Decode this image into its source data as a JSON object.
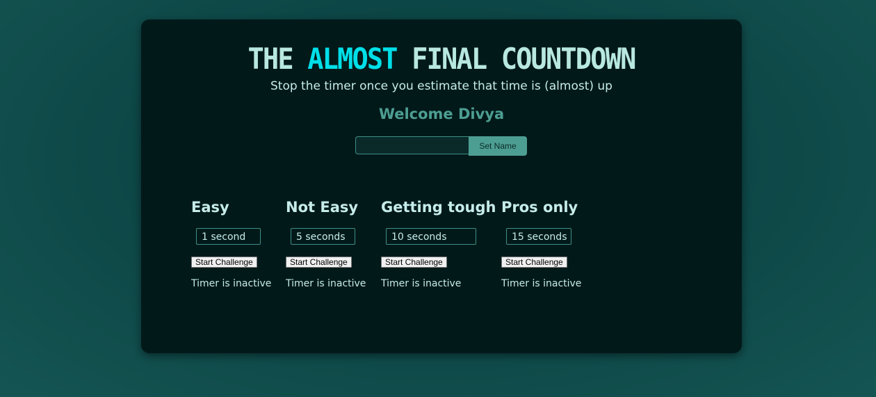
{
  "header": {
    "title_part1": "THE ",
    "title_accent": "ALMOST",
    "title_part2": " FINAL COUNTDOWN",
    "subtitle": "Stop the timer once you estimate that time is (almost) up",
    "welcome": "Welcome Divya"
  },
  "name_form": {
    "input_value": "",
    "button_label": "Set Name"
  },
  "challenges": [
    {
      "title": "Easy",
      "duration": "1 second",
      "button_label": "Start Challenge",
      "status": "Timer is inactive"
    },
    {
      "title": "Not Easy",
      "duration": "5 seconds",
      "button_label": "Start Challenge",
      "status": "Timer is inactive"
    },
    {
      "title": "Getting tough",
      "duration": "10 seconds",
      "button_label": "Start Challenge",
      "status": "Timer is inactive"
    },
    {
      "title": "Pros only",
      "duration": "15 seconds",
      "button_label": "Start Challenge",
      "status": "Timer is inactive"
    }
  ],
  "colors": {
    "page_background": "#0c4444",
    "card_background": "#02191a",
    "title_text": "#b8e8e0",
    "title_accent": "#00dfe8",
    "welcome_text": "#4d9e92",
    "button_accent": "#4d9e92"
  }
}
